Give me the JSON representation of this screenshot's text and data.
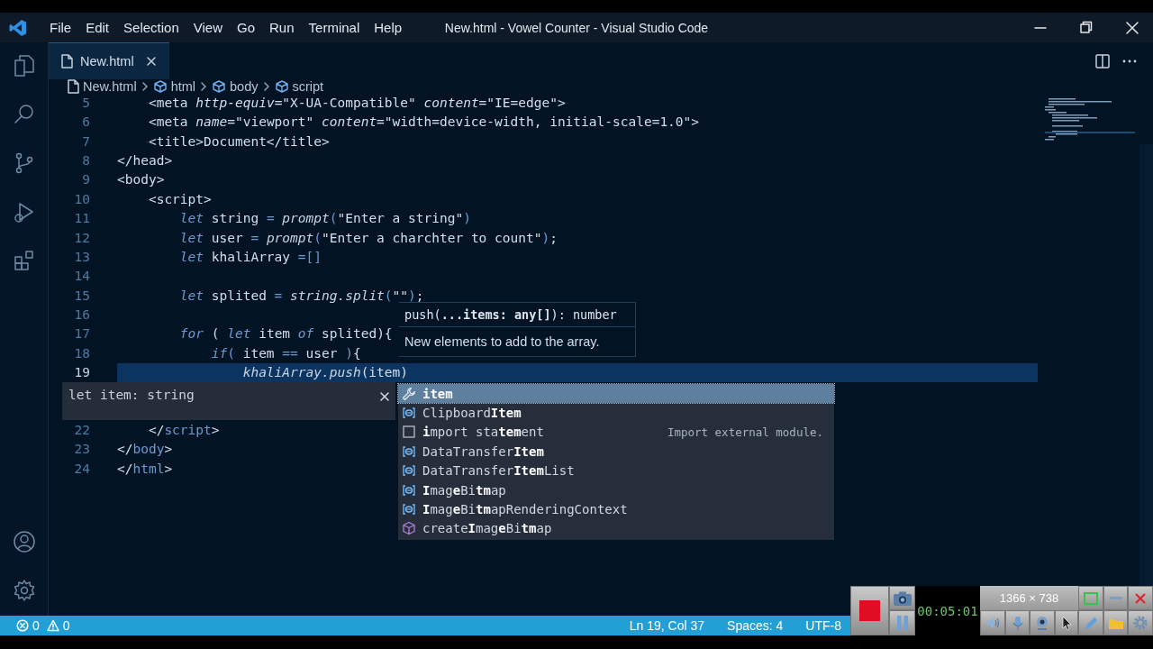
{
  "window": {
    "title": "New.html - Vowel Counter - Visual Studio Code"
  },
  "menu": [
    "File",
    "Edit",
    "Selection",
    "View",
    "Go",
    "Run",
    "Terminal",
    "Help"
  ],
  "tabs": [
    {
      "label": "New.html",
      "selected": true
    }
  ],
  "breadcrumbs": [
    {
      "kind": "file",
      "label": "New.html"
    },
    {
      "kind": "element",
      "label": "html"
    },
    {
      "kind": "element",
      "label": "body"
    },
    {
      "kind": "element",
      "label": "script"
    }
  ],
  "editor": {
    "lines": [
      {
        "number": "5",
        "selected": false,
        "tokens": [
          {
            "kind": "txt",
            "text": "    <meta "
          },
          {
            "kind": "attr",
            "text": "http-equiv"
          },
          {
            "kind": "txt",
            "text": "=\"X-UA-Compatible\" "
          },
          {
            "kind": "attr",
            "text": "content"
          },
          {
            "kind": "txt",
            "text": "=\"IE=edge\">"
          }
        ]
      },
      {
        "number": "6",
        "selected": false,
        "tokens": [
          {
            "kind": "txt",
            "text": "    <meta "
          },
          {
            "kind": "attr",
            "text": "name"
          },
          {
            "kind": "txt",
            "text": "=\"viewport\" "
          },
          {
            "kind": "attr",
            "text": "content"
          },
          {
            "kind": "txt",
            "text": "=\"width=device-width, initial-scale=1.0\">"
          }
        ]
      },
      {
        "number": "7",
        "selected": false,
        "tokens": [
          {
            "kind": "txt",
            "text": "    <title>Document</title>"
          }
        ]
      },
      {
        "number": "8",
        "selected": false,
        "tokens": [
          {
            "kind": "txt",
            "text": "</head>"
          }
        ]
      },
      {
        "number": "9",
        "selected": false,
        "tokens": [
          {
            "kind": "txt",
            "text": "<body>"
          }
        ]
      },
      {
        "number": "10",
        "selected": false,
        "tokens": [
          {
            "kind": "txt",
            "text": "    <script>"
          }
        ]
      },
      {
        "number": "11",
        "selected": false,
        "tokens": [
          {
            "kind": "kw",
            "text": "        let"
          },
          {
            "kind": "txt",
            "text": " string "
          },
          {
            "kind": "op",
            "text": "= "
          },
          {
            "kind": "fn",
            "text": "prompt"
          },
          {
            "kind": "op",
            "text": "("
          },
          {
            "kind": "txt",
            "text": "\"Enter a string\""
          },
          {
            "kind": "op",
            "text": ")"
          }
        ]
      },
      {
        "number": "12",
        "selected": false,
        "tokens": [
          {
            "kind": "kw",
            "text": "        let"
          },
          {
            "kind": "txt",
            "text": " user "
          },
          {
            "kind": "op",
            "text": "= "
          },
          {
            "kind": "fn",
            "text": "prompt"
          },
          {
            "kind": "op",
            "text": "("
          },
          {
            "kind": "txt",
            "text": "\"Enter a charchter to count\""
          },
          {
            "kind": "op",
            "text": ")"
          },
          {
            "kind": "txt",
            "text": ";"
          }
        ]
      },
      {
        "number": "13",
        "selected": false,
        "tokens": [
          {
            "kind": "kw",
            "text": "        let"
          },
          {
            "kind": "txt",
            "text": " khaliArray "
          },
          {
            "kind": "op",
            "text": "=[]"
          }
        ]
      },
      {
        "number": "14",
        "selected": false
      },
      {
        "number": "15",
        "selected": false,
        "tokens": [
          {
            "kind": "kw",
            "text": "        let"
          },
          {
            "kind": "txt",
            "text": " splited "
          },
          {
            "kind": "op",
            "text": "= "
          },
          {
            "kind": "fn",
            "text": "string.split"
          },
          {
            "kind": "op",
            "text": "("
          },
          {
            "kind": "txt",
            "text": "\"\""
          },
          {
            "kind": "op",
            "text": ")"
          },
          {
            "kind": "txt",
            "text": ";"
          }
        ]
      },
      {
        "number": "16",
        "selected": false
      },
      {
        "number": "17",
        "selected": false,
        "tokens": [
          {
            "kind": "kw",
            "text": "        for"
          },
          {
            "kind": "txt",
            "text": " ( "
          },
          {
            "kind": "kw",
            "text": "let"
          },
          {
            "kind": "txt",
            "text": " item "
          },
          {
            "kind": "kw",
            "text": "of"
          },
          {
            "kind": "txt",
            "text": " splited){"
          }
        ]
      },
      {
        "number": "18",
        "selected": false,
        "tokens": [
          {
            "kind": "kw",
            "text": "            if"
          },
          {
            "kind": "op",
            "text": "("
          },
          {
            "kind": "txt",
            "text": " item "
          },
          {
            "kind": "op",
            "text": "=="
          },
          {
            "kind": "txt",
            "text": " user "
          },
          {
            "kind": "op",
            "text": ")"
          },
          {
            "kind": "txt",
            "text": "{"
          }
        ]
      },
      {
        "number": "19",
        "selected": true,
        "tokens": [
          {
            "kind": "fn",
            "text": "                khaliArray.push"
          },
          {
            "kind": "txt",
            "text": "(item)"
          }
        ]
      },
      {
        "number": "22",
        "selected": false,
        "tokens": [
          {
            "kind": "txt",
            "text": "    </"
          },
          {
            "kind": "op",
            "text": "script"
          },
          {
            "kind": "txt",
            "text": ">"
          }
        ]
      },
      {
        "number": "23",
        "selected": false,
        "tokens": [
          {
            "kind": "txt",
            "text": "</"
          },
          {
            "kind": "op",
            "text": "body"
          },
          {
            "kind": "txt",
            "text": ">"
          }
        ]
      },
      {
        "number": "24",
        "selected": false,
        "tokens": [
          {
            "kind": "txt",
            "text": "</"
          },
          {
            "kind": "op",
            "text": "html"
          },
          {
            "kind": "txt",
            "text": ">"
          }
        ]
      }
    ],
    "type_hover": {
      "text": "let item: string"
    },
    "signature_help": {
      "signature": "push(**...items: any[]**): number",
      "documentation": "New elements to add to the array."
    },
    "suggestions": [
      {
        "kind": "tool",
        "label": "**item**",
        "selected": true
      },
      {
        "kind": "variable",
        "label": "Clipboard**Item**",
        "selected": false
      },
      {
        "kind": "snippet",
        "label": "**i**mport sta**tem**ent",
        "detail": "Import external module.",
        "selected": false
      },
      {
        "kind": "variable",
        "label": "DataTransfer**Item**",
        "selected": false
      },
      {
        "kind": "variable",
        "label": "DataTransfer**Item**List",
        "selected": false
      },
      {
        "kind": "variable",
        "label": "**I**mag**e**Bi**tm**ap",
        "selected": false
      },
      {
        "kind": "variable",
        "label": "**I**mag**e**Bi**tm**apRenderingContext",
        "selected": false
      },
      {
        "kind": "method",
        "label": "create**I**mag**e**Bi**tm**ap",
        "selected": false
      }
    ]
  },
  "status_bar": {
    "errors": "0",
    "warnings": "0",
    "items": [
      "Ln 19, Col 37",
      "Spaces: 4",
      "UTF-8"
    ]
  },
  "recorder": {
    "timer": "00:05:01",
    "resolution": "1366 × 738"
  }
}
